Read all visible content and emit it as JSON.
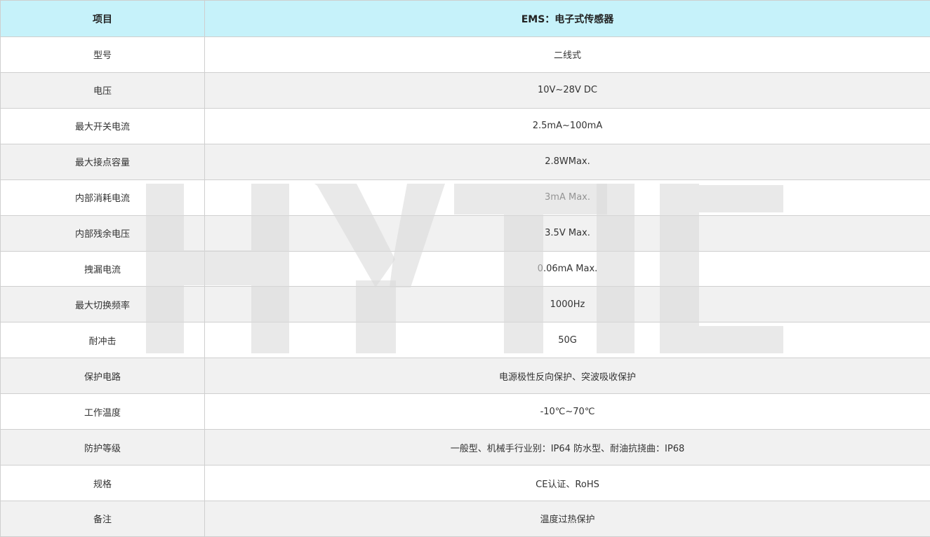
{
  "header": {
    "col1": "项目",
    "col2": "EMS：电子式传感器"
  },
  "rows": [
    {
      "label": "型号",
      "value": "二线式"
    },
    {
      "label": "电压",
      "value": "10V~28V DC"
    },
    {
      "label": "最大开关电流",
      "value": "2.5mA~100mA"
    },
    {
      "label": "最大接点容量",
      "value": "2.8WMax."
    },
    {
      "label": "内部消耗电流",
      "value": "3mA Max."
    },
    {
      "label": "内部残余电压",
      "value": "3.5V Max."
    },
    {
      "label": "拽漏电流",
      "value": "0.06mA Max."
    },
    {
      "label": "最大切换频率",
      "value": "1000Hz"
    },
    {
      "label": "耐冲击",
      "value": "50G"
    },
    {
      "label": "保护电路",
      "value": "电源极性反向保护、突波吸收保护"
    },
    {
      "label": "工作温度",
      "value": "-10℃~70℃"
    },
    {
      "label": "防护等级",
      "value": "一般型、机械手行业别：IP64 防水型、耐油抗挠曲：IP68"
    },
    {
      "label": "规格",
      "value": "CE认证、RoHS"
    },
    {
      "label": "备注",
      "value": "温度过热保护"
    }
  ],
  "watermark": {
    "text": "HYTIC",
    "color": "#d9d9d9"
  }
}
